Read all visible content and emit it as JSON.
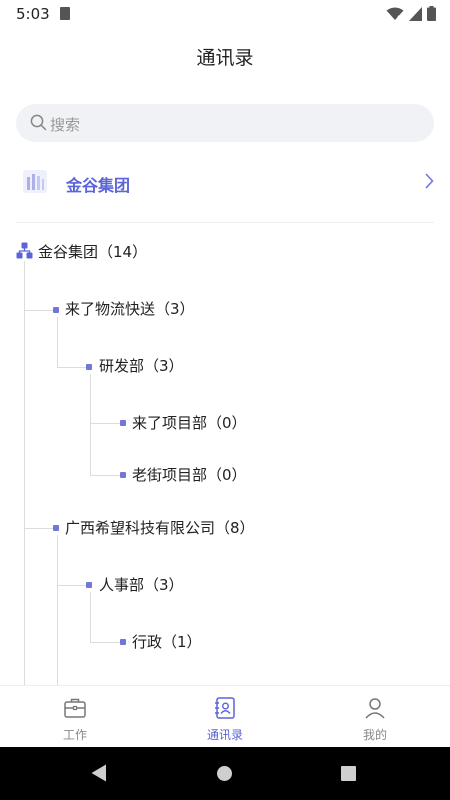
{
  "status_bar": {
    "time": "5:03"
  },
  "header": {
    "title": "通讯录"
  },
  "search": {
    "placeholder": "搜索"
  },
  "org": {
    "name": "金谷集团"
  },
  "tree": {
    "root": {
      "label": "金谷集团（14）"
    },
    "n1": {
      "label": "来了物流快送（3）"
    },
    "n1_1": {
      "label": "研发部（3）"
    },
    "n1_1_1": {
      "label": "来了项目部（0）"
    },
    "n1_1_2": {
      "label": "老街项目部（0）"
    },
    "n2": {
      "label": "广西希望科技有限公司（8）"
    },
    "n2_1": {
      "label": "人事部（3）"
    },
    "n2_1_1": {
      "label": "行政（1）"
    }
  },
  "tabs": [
    {
      "label": "工作",
      "icon": "briefcase-icon"
    },
    {
      "label": "通讯录",
      "icon": "contacts-icon",
      "active": true
    },
    {
      "label": "我的",
      "icon": "user-icon"
    }
  ],
  "colors": {
    "accent": "#5b64d8",
    "dot": "#6f77de",
    "search_bg": "#f1f2f6"
  }
}
